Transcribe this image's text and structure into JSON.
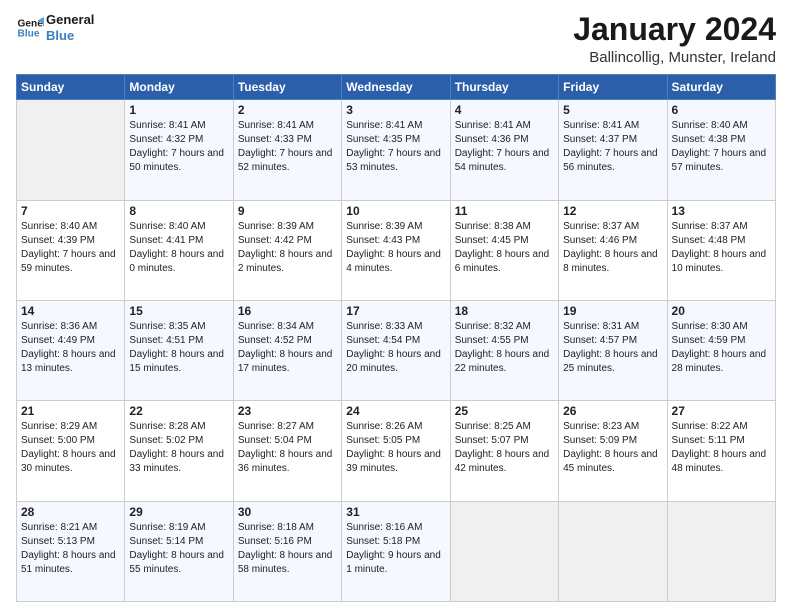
{
  "logo": {
    "line1": "General",
    "line2": "Blue"
  },
  "header": {
    "title": "January 2024",
    "location": "Ballincollig, Munster, Ireland"
  },
  "days_of_week": [
    "Sunday",
    "Monday",
    "Tuesday",
    "Wednesday",
    "Thursday",
    "Friday",
    "Saturday"
  ],
  "weeks": [
    [
      {
        "day": "",
        "sunrise": "",
        "sunset": "",
        "daylight": ""
      },
      {
        "day": "1",
        "sunrise": "Sunrise: 8:41 AM",
        "sunset": "Sunset: 4:32 PM",
        "daylight": "Daylight: 7 hours and 50 minutes."
      },
      {
        "day": "2",
        "sunrise": "Sunrise: 8:41 AM",
        "sunset": "Sunset: 4:33 PM",
        "daylight": "Daylight: 7 hours and 52 minutes."
      },
      {
        "day": "3",
        "sunrise": "Sunrise: 8:41 AM",
        "sunset": "Sunset: 4:35 PM",
        "daylight": "Daylight: 7 hours and 53 minutes."
      },
      {
        "day": "4",
        "sunrise": "Sunrise: 8:41 AM",
        "sunset": "Sunset: 4:36 PM",
        "daylight": "Daylight: 7 hours and 54 minutes."
      },
      {
        "day": "5",
        "sunrise": "Sunrise: 8:41 AM",
        "sunset": "Sunset: 4:37 PM",
        "daylight": "Daylight: 7 hours and 56 minutes."
      },
      {
        "day": "6",
        "sunrise": "Sunrise: 8:40 AM",
        "sunset": "Sunset: 4:38 PM",
        "daylight": "Daylight: 7 hours and 57 minutes."
      }
    ],
    [
      {
        "day": "7",
        "sunrise": "Sunrise: 8:40 AM",
        "sunset": "Sunset: 4:39 PM",
        "daylight": "Daylight: 7 hours and 59 minutes."
      },
      {
        "day": "8",
        "sunrise": "Sunrise: 8:40 AM",
        "sunset": "Sunset: 4:41 PM",
        "daylight": "Daylight: 8 hours and 0 minutes."
      },
      {
        "day": "9",
        "sunrise": "Sunrise: 8:39 AM",
        "sunset": "Sunset: 4:42 PM",
        "daylight": "Daylight: 8 hours and 2 minutes."
      },
      {
        "day": "10",
        "sunrise": "Sunrise: 8:39 AM",
        "sunset": "Sunset: 4:43 PM",
        "daylight": "Daylight: 8 hours and 4 minutes."
      },
      {
        "day": "11",
        "sunrise": "Sunrise: 8:38 AM",
        "sunset": "Sunset: 4:45 PM",
        "daylight": "Daylight: 8 hours and 6 minutes."
      },
      {
        "day": "12",
        "sunrise": "Sunrise: 8:37 AM",
        "sunset": "Sunset: 4:46 PM",
        "daylight": "Daylight: 8 hours and 8 minutes."
      },
      {
        "day": "13",
        "sunrise": "Sunrise: 8:37 AM",
        "sunset": "Sunset: 4:48 PM",
        "daylight": "Daylight: 8 hours and 10 minutes."
      }
    ],
    [
      {
        "day": "14",
        "sunrise": "Sunrise: 8:36 AM",
        "sunset": "Sunset: 4:49 PM",
        "daylight": "Daylight: 8 hours and 13 minutes."
      },
      {
        "day": "15",
        "sunrise": "Sunrise: 8:35 AM",
        "sunset": "Sunset: 4:51 PM",
        "daylight": "Daylight: 8 hours and 15 minutes."
      },
      {
        "day": "16",
        "sunrise": "Sunrise: 8:34 AM",
        "sunset": "Sunset: 4:52 PM",
        "daylight": "Daylight: 8 hours and 17 minutes."
      },
      {
        "day": "17",
        "sunrise": "Sunrise: 8:33 AM",
        "sunset": "Sunset: 4:54 PM",
        "daylight": "Daylight: 8 hours and 20 minutes."
      },
      {
        "day": "18",
        "sunrise": "Sunrise: 8:32 AM",
        "sunset": "Sunset: 4:55 PM",
        "daylight": "Daylight: 8 hours and 22 minutes."
      },
      {
        "day": "19",
        "sunrise": "Sunrise: 8:31 AM",
        "sunset": "Sunset: 4:57 PM",
        "daylight": "Daylight: 8 hours and 25 minutes."
      },
      {
        "day": "20",
        "sunrise": "Sunrise: 8:30 AM",
        "sunset": "Sunset: 4:59 PM",
        "daylight": "Daylight: 8 hours and 28 minutes."
      }
    ],
    [
      {
        "day": "21",
        "sunrise": "Sunrise: 8:29 AM",
        "sunset": "Sunset: 5:00 PM",
        "daylight": "Daylight: 8 hours and 30 minutes."
      },
      {
        "day": "22",
        "sunrise": "Sunrise: 8:28 AM",
        "sunset": "Sunset: 5:02 PM",
        "daylight": "Daylight: 8 hours and 33 minutes."
      },
      {
        "day": "23",
        "sunrise": "Sunrise: 8:27 AM",
        "sunset": "Sunset: 5:04 PM",
        "daylight": "Daylight: 8 hours and 36 minutes."
      },
      {
        "day": "24",
        "sunrise": "Sunrise: 8:26 AM",
        "sunset": "Sunset: 5:05 PM",
        "daylight": "Daylight: 8 hours and 39 minutes."
      },
      {
        "day": "25",
        "sunrise": "Sunrise: 8:25 AM",
        "sunset": "Sunset: 5:07 PM",
        "daylight": "Daylight: 8 hours and 42 minutes."
      },
      {
        "day": "26",
        "sunrise": "Sunrise: 8:23 AM",
        "sunset": "Sunset: 5:09 PM",
        "daylight": "Daylight: 8 hours and 45 minutes."
      },
      {
        "day": "27",
        "sunrise": "Sunrise: 8:22 AM",
        "sunset": "Sunset: 5:11 PM",
        "daylight": "Daylight: 8 hours and 48 minutes."
      }
    ],
    [
      {
        "day": "28",
        "sunrise": "Sunrise: 8:21 AM",
        "sunset": "Sunset: 5:13 PM",
        "daylight": "Daylight: 8 hours and 51 minutes."
      },
      {
        "day": "29",
        "sunrise": "Sunrise: 8:19 AM",
        "sunset": "Sunset: 5:14 PM",
        "daylight": "Daylight: 8 hours and 55 minutes."
      },
      {
        "day": "30",
        "sunrise": "Sunrise: 8:18 AM",
        "sunset": "Sunset: 5:16 PM",
        "daylight": "Daylight: 8 hours and 58 minutes."
      },
      {
        "day": "31",
        "sunrise": "Sunrise: 8:16 AM",
        "sunset": "Sunset: 5:18 PM",
        "daylight": "Daylight: 9 hours and 1 minute."
      },
      {
        "day": "",
        "sunrise": "",
        "sunset": "",
        "daylight": ""
      },
      {
        "day": "",
        "sunrise": "",
        "sunset": "",
        "daylight": ""
      },
      {
        "day": "",
        "sunrise": "",
        "sunset": "",
        "daylight": ""
      }
    ]
  ]
}
